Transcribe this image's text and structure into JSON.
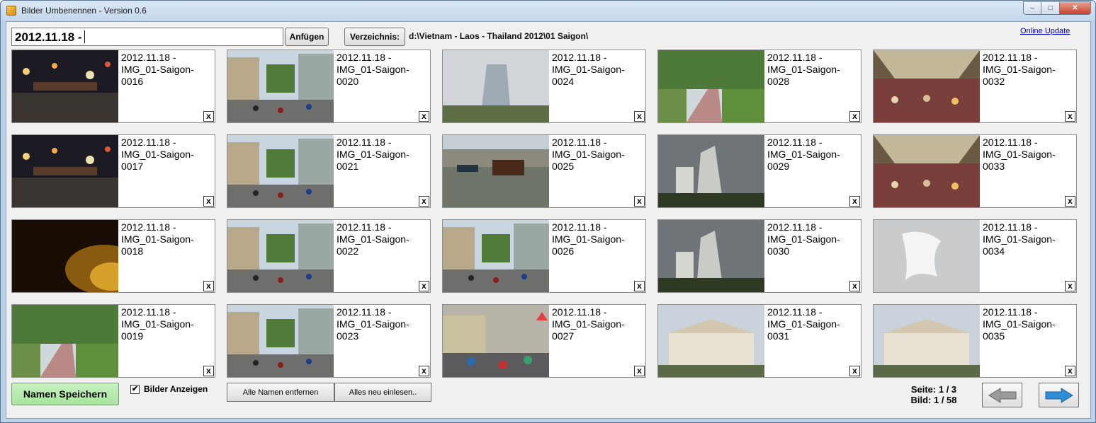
{
  "window": {
    "title": "Bilder Umbenennen  - Version 0.6",
    "controls": {
      "minimize": "–",
      "maximize": "□",
      "close": "✕"
    }
  },
  "toolbar": {
    "name_value": "2012.11.18 -",
    "append_label": "Anfügen",
    "directory_label": "Verzeichnis:",
    "directory_path": "d:\\Vietnam - Laos - Thailand 2012\\01 Saigon\\",
    "online_update": "Online Update"
  },
  "images": [
    {
      "name": "2012.11.18 - IMG_01-Saigon-0016",
      "delete": "x",
      "thumb": "night"
    },
    {
      "name": "2012.11.18 - IMG_01-Saigon-0020",
      "delete": "x",
      "thumb": "street"
    },
    {
      "name": "2012.11.18 - IMG_01-Saigon-0024",
      "delete": "x",
      "thumb": "tower-haze"
    },
    {
      "name": "2012.11.18 - IMG_01-Saigon-0028",
      "delete": "x",
      "thumb": "park"
    },
    {
      "name": "2012.11.18 - IMG_01-Saigon-0032",
      "delete": "x",
      "thumb": "market"
    },
    {
      "name": "2012.11.18 - IMG_01-Saigon-0017",
      "delete": "x",
      "thumb": "night"
    },
    {
      "name": "2012.11.18 - IMG_01-Saigon-0021",
      "delete": "x",
      "thumb": "street"
    },
    {
      "name": "2012.11.18 - IMG_01-Saigon-0025",
      "delete": "x",
      "thumb": "river"
    },
    {
      "name": "2012.11.18 - IMG_01-Saigon-0029",
      "delete": "x",
      "thumb": "tower-dark"
    },
    {
      "name": "2012.11.18 - IMG_01-Saigon-0033",
      "delete": "x",
      "thumb": "market"
    },
    {
      "name": "2012.11.18 - IMG_01-Saigon-0018",
      "delete": "x",
      "thumb": "blur"
    },
    {
      "name": "2012.11.18 - IMG_01-Saigon-0022",
      "delete": "x",
      "thumb": "street"
    },
    {
      "name": "2012.11.18 - IMG_01-Saigon-0026",
      "delete": "x",
      "thumb": "street"
    },
    {
      "name": "2012.11.18 - IMG_01-Saigon-0030",
      "delete": "x",
      "thumb": "tower-dark"
    },
    {
      "name": "2012.11.18 - IMG_01-Saigon-0034",
      "delete": "x",
      "thumb": "white-relief"
    },
    {
      "name": "2012.11.18 - IMG_01-Saigon-0019",
      "delete": "x",
      "thumb": "park"
    },
    {
      "name": "2012.11.18 - IMG_01-Saigon-0023",
      "delete": "x",
      "thumb": "street"
    },
    {
      "name": "2012.11.18 - IMG_01-Saigon-0027",
      "delete": "x",
      "thumb": "traffic"
    },
    {
      "name": "2012.11.18 - IMG_01-Saigon-0031",
      "delete": "x",
      "thumb": "building"
    },
    {
      "name": "2012.11.18 - IMG_01-Saigon-0035",
      "delete": "x",
      "thumb": "building"
    }
  ],
  "footer": {
    "save_label": "Namen Speichern",
    "show_images_label": "Bilder Anzeigen",
    "show_images_checked": "✔",
    "remove_all_label": "Alle Namen entfernen",
    "reload_label": "Alles neu einlesen..",
    "page_info": "Seite: 1 / 3",
    "image_info": "Bild: 1 / 58",
    "prev_icon": "arrow-left-icon",
    "next_icon": "arrow-right-icon",
    "next_color": "#2f8fd6",
    "prev_color": "#9a9a9a"
  }
}
